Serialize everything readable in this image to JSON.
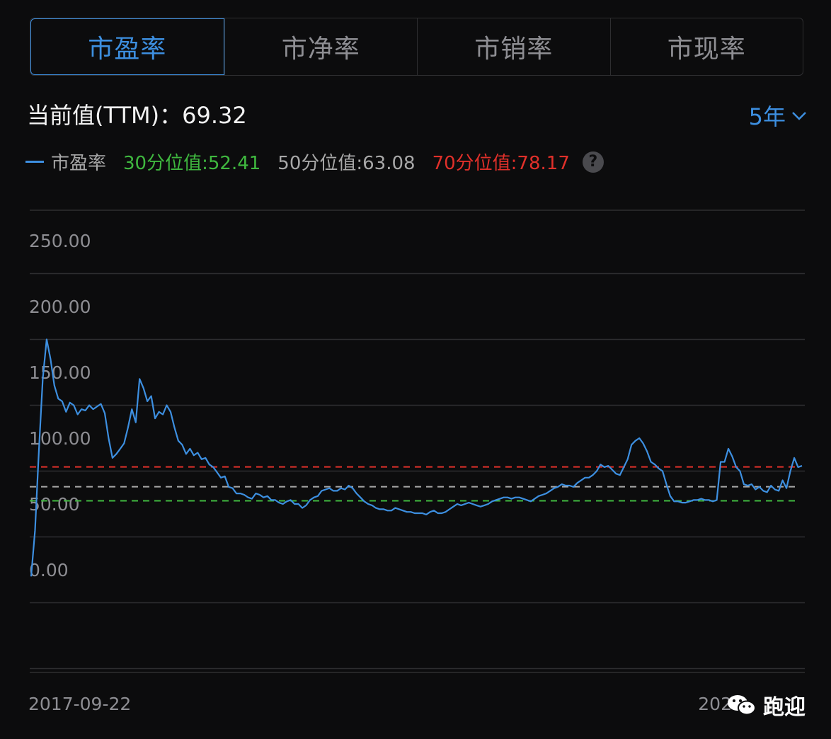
{
  "tabs": [
    "市盈率",
    "市净率",
    "市销率",
    "市现率"
  ],
  "active_tab": 0,
  "current_value_label": "当前值(TTM)：69.32",
  "period_label": "5年",
  "legend": {
    "series_label": "市盈率",
    "p30": "30分位值:52.41",
    "p50": "50分位值:63.08",
    "p70": "70分位值:78.17"
  },
  "start_date": "2017-09-22",
  "end_date_partial": "202",
  "watermark": "跑迎",
  "colors": {
    "accent": "#3d8fe0",
    "p30": "#3fb83f",
    "p50": "#a8a8a8",
    "p70": "#e0302a",
    "grid": "#2e2e30",
    "tick": "#8e8e93"
  },
  "chart_data": {
    "type": "line",
    "title": "",
    "xlabel": "",
    "ylabel": "",
    "ylim": [
      -50,
      275
    ],
    "yticks": [
      0,
      50,
      100,
      150,
      200,
      250
    ],
    "ytick_labels": [
      "0.00",
      "50.00",
      "100.00",
      "150.00",
      "200.00",
      "250.00"
    ],
    "x_start": "2017-09-22",
    "reference_lines": [
      {
        "name": "30分位值",
        "value": 52.41,
        "color": "#3fb83f"
      },
      {
        "name": "50分位值",
        "value": 63.08,
        "color": "#a8a8a8"
      },
      {
        "name": "70分位值",
        "value": 78.17,
        "color": "#e0302a"
      }
    ],
    "series": [
      {
        "name": "市盈率",
        "color": "#3d8fe0",
        "values": [
          -5,
          30,
          90,
          145,
          175,
          160,
          140,
          130,
          128,
          120,
          127,
          125,
          118,
          122,
          121,
          125,
          122,
          124,
          126,
          119,
          100,
          85,
          88,
          92,
          96,
          108,
          122,
          112,
          145,
          138,
          128,
          132,
          115,
          120,
          118,
          125,
          120,
          108,
          98,
          95,
          88,
          92,
          87,
          89,
          84,
          85,
          80,
          78,
          74,
          70,
          71,
          63,
          62,
          58,
          58,
          57,
          55,
          54,
          58,
          57,
          55,
          56,
          53,
          53,
          51,
          50,
          52,
          53,
          50,
          50,
          47,
          49,
          53,
          55,
          56,
          60,
          61,
          62,
          60,
          60,
          62,
          61,
          64,
          62,
          58,
          55,
          52,
          50,
          49,
          47,
          46,
          46,
          45,
          45,
          47,
          46,
          45,
          44,
          44,
          43,
          43,
          43,
          42,
          44,
          45,
          43,
          43,
          44,
          46,
          48,
          50,
          49,
          50,
          51,
          50,
          49,
          48,
          49,
          50,
          52,
          53,
          54,
          55,
          55,
          54,
          55,
          55,
          54,
          53,
          52,
          54,
          56,
          57,
          58,
          60,
          62,
          63,
          65,
          64,
          64,
          63,
          66,
          68,
          70,
          70,
          72,
          75,
          80,
          78,
          79,
          76,
          73,
          72,
          78,
          84,
          95,
          98,
          100,
          96,
          90,
          82,
          80,
          77,
          75,
          65,
          56,
          52,
          52,
          51,
          51,
          52,
          53,
          53,
          54,
          53,
          53,
          52,
          53,
          82,
          82,
          92,
          86,
          78,
          75,
          65,
          64,
          65,
          61,
          63,
          60,
          59,
          64,
          61,
          60,
          68,
          62,
          75,
          85,
          78,
          79
        ]
      }
    ]
  }
}
